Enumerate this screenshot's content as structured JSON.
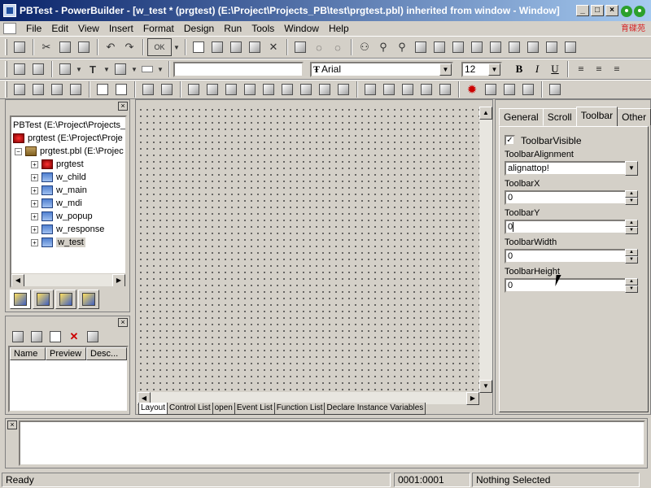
{
  "window": {
    "title": "PBTest - PowerBuilder - [w_test * (prgtest) (E:\\Project\\Projects_PB\\test\\prgtest.pbl) inherited from window - Window]",
    "logo_text": "育碟苑"
  },
  "menu": [
    "File",
    "Edit",
    "View",
    "Insert",
    "Format",
    "Design",
    "Run",
    "Tools",
    "Window",
    "Help"
  ],
  "format_toolbar": {
    "font_name": "Arial",
    "font_size": "12",
    "bold": "B",
    "italic": "I",
    "underline": "U",
    "ok_label": "OK"
  },
  "system_tree": {
    "root": "PBTest (E:\\Project\\Projects_",
    "target": "prgtest (E:\\Project\\Proje",
    "library": "prgtest.pbl (E:\\Projec",
    "objects": [
      "prgtest",
      "w_child",
      "w_main",
      "w_mdi",
      "w_popup",
      "w_response",
      "w_test"
    ]
  },
  "clip_list": {
    "columns": [
      "Name",
      "Preview",
      "Desc..."
    ]
  },
  "painter_tabs": [
    "Layout",
    "Control List",
    "open",
    "Event List",
    "Function List",
    "Declare Instance Variables"
  ],
  "properties": {
    "tabs": [
      "General",
      "Scroll",
      "Toolbar",
      "Other"
    ],
    "active_tab": "Toolbar",
    "toolbar_visible_label": "ToolbarVisible",
    "toolbar_visible_checked": "✓",
    "alignment_label": "ToolbarAlignment",
    "alignment_value": "alignattop!",
    "x_label": "ToolbarX",
    "x_value": "0",
    "y_label": "ToolbarY",
    "y_value": "0",
    "width_label": "ToolbarWidth",
    "width_value": "0",
    "height_label": "ToolbarHeight",
    "height_value": "0"
  },
  "status": {
    "text": "Ready",
    "position": "0001:0001",
    "selection": "Nothing Selected"
  }
}
